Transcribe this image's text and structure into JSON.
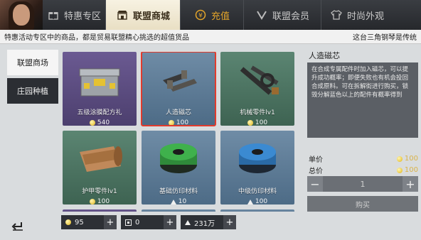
{
  "tabs": [
    {
      "label": "特惠专区",
      "icon": "gift-icon"
    },
    {
      "label": "联盟商城",
      "icon": "shop-icon",
      "active": true
    },
    {
      "label": "充值",
      "icon": "coin-icon"
    },
    {
      "label": "联盟会员",
      "icon": "v-badge-icon"
    },
    {
      "label": "时尚外观",
      "icon": "shirt-icon"
    }
  ],
  "notice": {
    "left": "特惠活动专区中的商品，都是贸易联盟精心挑选的超值货品",
    "right": "这台三角钢琴是传统"
  },
  "left_menu": [
    {
      "label": "联盟商场",
      "active": true
    },
    {
      "label": "庄园种植",
      "active": false
    }
  ],
  "items": [
    {
      "name": "五级涂膜配方礼",
      "price": "540",
      "currency": "coin",
      "bg": "purple",
      "icon": "case-icon"
    },
    {
      "name": "人造磁芯",
      "price": "100",
      "currency": "coin",
      "bg": "blue",
      "icon": "magnet-icon",
      "selected": true
    },
    {
      "name": "机械零件lv1",
      "price": "100",
      "currency": "coin",
      "bg": "green",
      "icon": "bolt-icon"
    },
    {
      "name": "护甲零件lv1",
      "price": "100",
      "currency": "coin",
      "bg": "green",
      "icon": "leather-icon"
    },
    {
      "name": "基础仿印材料",
      "price": "10",
      "currency": "tri",
      "bg": "blue",
      "icon": "green-spool-icon"
    },
    {
      "name": "中级仿印材料",
      "price": "100",
      "currency": "tri",
      "bg": "blue",
      "icon": "blue-spool-icon"
    }
  ],
  "currencies": [
    {
      "icon": "coin-icon",
      "value": "95"
    },
    {
      "icon": "ticket-icon",
      "value": "0"
    },
    {
      "icon": "triangle-icon",
      "value": "231万"
    }
  ],
  "detail": {
    "title": "人造磁芯",
    "desc": "在合成专属配件时加入磁芯，可以提升成功概率；即便失败也有机会投回合成原料。可在拆解街进行购买，锁毁分解蓝色以上的配件有概率得到",
    "unit_label": "单价",
    "unit_value": "100",
    "total_label": "总价",
    "total_value": "100",
    "quantity": "1",
    "buy_label": "购买"
  },
  "colors": {
    "accent": "#e13b2d",
    "coin": "#e0b41a"
  }
}
